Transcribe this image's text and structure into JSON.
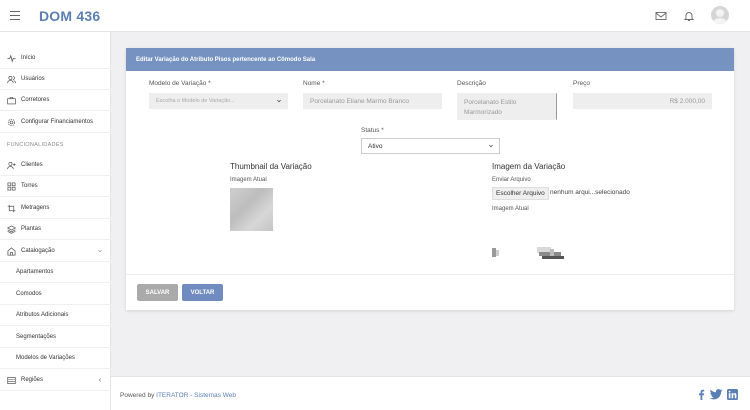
{
  "header": {
    "brand": "DOM 436"
  },
  "sidebar": {
    "items": [
      {
        "label": "Início"
      },
      {
        "label": "Usuários"
      },
      {
        "label": "Corretores"
      },
      {
        "label": "Configurar Financiamentos"
      }
    ],
    "section_label": "FUNCIONALIDADES",
    "func_items": [
      {
        "label": "Clientes"
      },
      {
        "label": "Torres"
      },
      {
        "label": "Metragens"
      },
      {
        "label": "Plantas"
      },
      {
        "label": "Catalogação"
      }
    ],
    "sub_items": [
      {
        "label": "Apartamentos"
      },
      {
        "label": "Comodos"
      },
      {
        "label": "Atributos Adicionais"
      },
      {
        "label": "Segmentações"
      },
      {
        "label": "Modelos de Variações"
      }
    ],
    "regions": {
      "label": "Regiões"
    }
  },
  "card": {
    "title": "Editar Variação do Atributo Pisos pertencente ao Cômodo Sala",
    "fields": {
      "modelo_label": "Modelo de Variação *",
      "modelo_placeholder": "Escolha o Modelo de Variação...",
      "nome_label": "Nome *",
      "nome_value": "Porcelanato Eliane Marmo Branco",
      "descricao_label": "Descrição",
      "descricao_line1": "Porcelanato Estilo",
      "descricao_line2": "Marmorizado",
      "preco_label": "Preço",
      "preco_value": "R$ 2.000,00",
      "status_label": "Status *",
      "status_value": "Ativo"
    },
    "thumbnail": {
      "title": "Thumbnail da Variação",
      "current_label": "Imagem Atual"
    },
    "image": {
      "title": "Imagem da Variação",
      "upload_label": "Enviar Arquivo",
      "choose_button": "Escolher Arquivo",
      "no_file_text": "nenhum arqui...selecionado",
      "current_label": "Imagem Atual"
    },
    "buttons": {
      "save": "SALVAR",
      "back": "VOLTAR"
    }
  },
  "footer": {
    "prefix": "Powered by ",
    "company": "ITERATOR - Sistemas Web"
  },
  "colors": {
    "brand": "#5a7fb5",
    "header_bar": "#7592c1",
    "button_primary": "#6f8bc0",
    "button_disabled": "#aaaaaa"
  }
}
